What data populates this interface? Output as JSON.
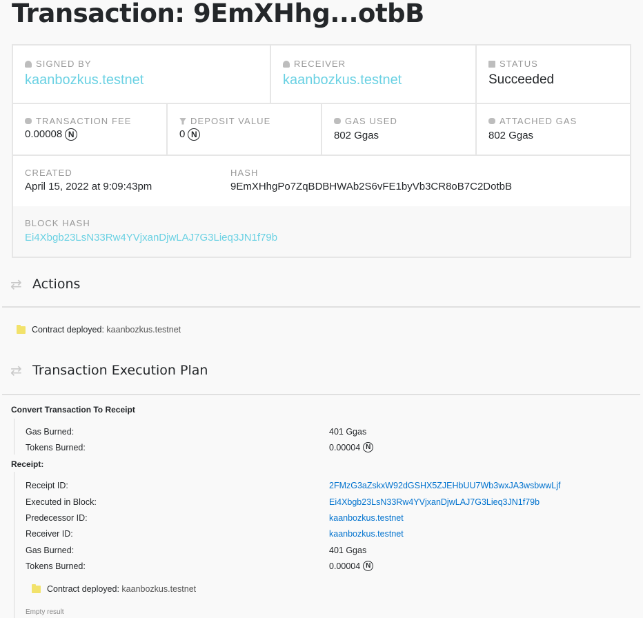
{
  "page": {
    "title": "Transaction: 9EmXHhg...otbB"
  },
  "summary": {
    "signed_by": {
      "label": "SIGNED BY",
      "value": "kaanbozkus.testnet"
    },
    "receiver": {
      "label": "RECEIVER",
      "value": "kaanbozkus.testnet"
    },
    "status": {
      "label": "STATUS",
      "value": "Succeeded"
    },
    "transaction_fee": {
      "label": "TRANSACTION FEE",
      "value": "0.00008"
    },
    "deposit_value": {
      "label": "DEPOSIT VALUE",
      "value": "0"
    },
    "gas_used": {
      "label": "GAS USED",
      "value": "802 Ggas"
    },
    "attached_gas": {
      "label": "ATTACHED GAS",
      "value": "802 Ggas"
    },
    "created": {
      "label": "CREATED",
      "value": "April 15, 2022 at 9:09:43pm"
    },
    "hash": {
      "label": "HASH",
      "value": "9EmXHhgPo7ZqBDBHWAb2S6vFE1byVb3CR8oB7C2DotbB"
    },
    "block_hash": {
      "label": "BLOCK HASH",
      "value": "Ei4Xbgb23LsN33Rw4YVjxanDjwLAJ7G3Lieq3JN1f79b"
    },
    "near_symbol": "N"
  },
  "actions": {
    "title": "Actions",
    "items": [
      {
        "prefix": "Contract deployed:",
        "account": "kaanbozkus.testnet"
      }
    ]
  },
  "plan": {
    "title": "Transaction Execution Plan",
    "convert": {
      "heading": "Convert Transaction To Receipt",
      "gas_burned": {
        "label": "Gas Burned:",
        "value": "401 Ggas"
      },
      "tokens_burned": {
        "label": "Tokens Burned:",
        "value": "0.00004"
      }
    },
    "receipt": {
      "heading": "Receipt:",
      "receipt_id": {
        "label": "Receipt ID:",
        "value": "2FMzG3aZskxW92dGSHX5ZJEHbUU7Wb3wxJA3wsbwwLjf"
      },
      "executed_in_block": {
        "label": "Executed in Block:",
        "value": "Ei4Xbgb23LsN33Rw4YVjxanDjwLAJ7G3Lieq3JN1f79b"
      },
      "predecessor_id": {
        "label": "Predecessor ID:",
        "value": "kaanbozkus.testnet"
      },
      "receiver_id": {
        "label": "Receiver ID:",
        "value": "kaanbozkus.testnet"
      },
      "gas_burned": {
        "label": "Gas Burned:",
        "value": "401 Ggas"
      },
      "tokens_burned": {
        "label": "Tokens Burned:",
        "value": "0.00004"
      },
      "action": {
        "prefix": "Contract deployed:",
        "account": "kaanbozkus.testnet"
      },
      "result": "Empty result"
    }
  },
  "colors": {
    "link": "#6ad1e3",
    "link_blue": "#0072ce",
    "folder": "#f2e26b"
  }
}
